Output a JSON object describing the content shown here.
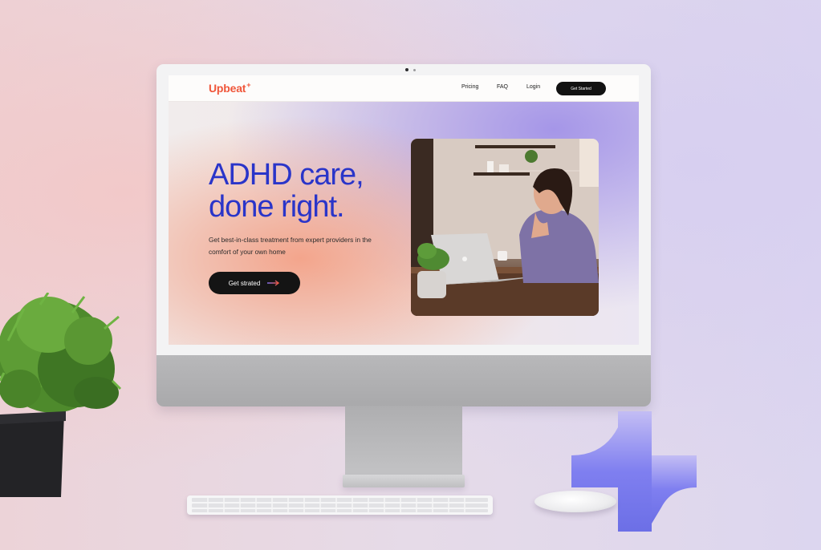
{
  "nav": {
    "logo_text": "Upbeat",
    "logo_mark": "+",
    "links": [
      "Pricing",
      "FAQ",
      "Login"
    ],
    "cta_label": "Get Started"
  },
  "hero": {
    "title_line1": "ADHD care,",
    "title_line2": "done right.",
    "subtitle": "Get best-in-class treatment from expert providers in the comfort of your own home",
    "cta_label": "Get strated",
    "cta_icon": "arrow-right-icon",
    "image_alt": "woman-smiling-at-laptop-in-kitchen"
  },
  "colors": {
    "brand_orange": "#f0563a",
    "headline_blue": "#2a35c9",
    "button_dark": "#121212",
    "brand_mark_violet": "#6c6fe6"
  }
}
